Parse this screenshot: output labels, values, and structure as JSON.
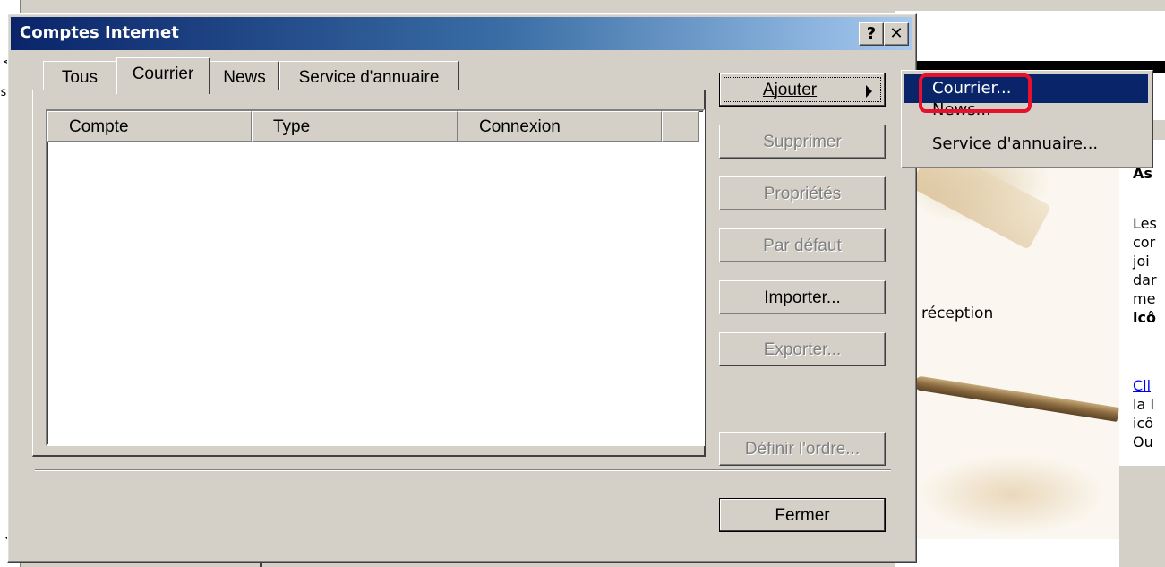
{
  "dialog": {
    "title": "Comptes Internet",
    "help_label": "?",
    "close_label": "✕"
  },
  "tabs": [
    {
      "label": "Tous"
    },
    {
      "label": "Courrier"
    },
    {
      "label": "News"
    },
    {
      "label": "Service d'annuaire"
    }
  ],
  "active_tab": "Courrier",
  "list": {
    "columns": [
      "Compte",
      "Type",
      "Connexion"
    ],
    "rows": []
  },
  "buttons": {
    "add": "Ajouter",
    "remove": "Supprimer",
    "properties": "Propriétés",
    "default": "Par défaut",
    "import": "Importer...",
    "export": "Exporter...",
    "set_order": "Définir l'ordre...",
    "close": "Fermer"
  },
  "add_menu": {
    "items": [
      "Courrier...",
      "News...",
      "Service d'annuaire..."
    ],
    "highlighted": "Courrier..."
  },
  "background": {
    "reception_text": "réception",
    "right_lines": [
      "As",
      "Les",
      "cor",
      "joi",
      "dar",
      "me",
      "icô",
      "Cli",
      "la I",
      "icô",
      "Ou"
    ],
    "left_glyphs": [
      "<",
      "ss"
    ]
  },
  "colors": {
    "title_gradient_start": "#0a246a",
    "title_gradient_end": "#a6caf0",
    "menu_highlight": "#0a246a",
    "annotation_red": "#e8102b"
  }
}
